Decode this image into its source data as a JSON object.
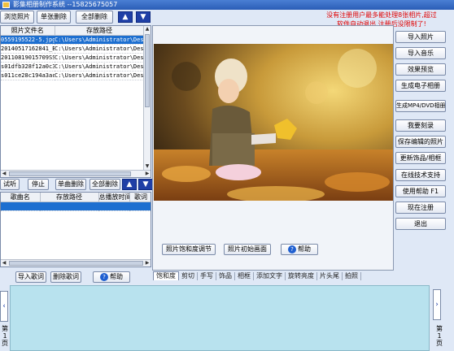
{
  "window": {
    "title": "影集相册制作系统  --15825675057"
  },
  "notice": {
    "line1": "没有注册用户最多能处理8张相片,超过",
    "line2": "软件自动退出,注册后没限制了!"
  },
  "toolbar": {
    "browse": "浏览照片",
    "delete_one": "单张删除",
    "delete_all": "全部删除",
    "up": "▲",
    "down": "▼"
  },
  "photo_list": {
    "columns": [
      "照片文件名",
      "存放路径"
    ],
    "rows": [
      {
        "name": "0559195522-5.jpg",
        "path": "C:\\Users\\Administrator\\Des"
      },
      {
        "name": "20140517162841_B",
        "path": "C:\\Users\\Administrator\\Des"
      },
      {
        "name": "20110819015709SS",
        "path": "C:\\Users\\Administrator\\Des"
      },
      {
        "name": "s01dfb328f12a0c3",
        "path": "C:\\Users\\Administrator\\Des"
      },
      {
        "name": "s011ce28c194a3ac",
        "path": "C:\\Users\\Administrator\\Des"
      }
    ]
  },
  "music_toolbar": {
    "listen": "试听",
    "stop": "停止",
    "delete_one": "单曲删除",
    "delete_all": "全部删除",
    "up": "▲",
    "down": "▼"
  },
  "music_list": {
    "columns": [
      "歌曲名",
      "存放路径",
      "总播放时间",
      "歌词"
    ]
  },
  "lyrics_toolbar": {
    "import": "导入歌词",
    "delete": "删除歌词",
    "help": "帮助"
  },
  "preview": {
    "adjust_saturation": "照片饱和度调节",
    "init_screen": "照片初始画面",
    "help": "帮助"
  },
  "tabs": [
    "饱和度",
    "剪切",
    "手写",
    "饰品",
    "相框",
    "添加文字",
    "旋转亮度",
    "片头尾",
    "拍照"
  ],
  "right_buttons": [
    "导入照片",
    "导入音乐",
    "效果预览",
    "生成电子相册",
    "生成MP4/DVD相册",
    "我要刻录",
    "保存编辑的照片",
    "更新饰品/相框",
    "在线技术支持",
    "使用帮助  F1",
    "现在注册",
    "退出"
  ],
  "pager": {
    "left": [
      "第",
      "1",
      "页"
    ],
    "right": [
      "第",
      "1",
      "页"
    ]
  },
  "icons": {
    "up": "arrow-up-icon",
    "down": "arrow-down-icon",
    "help": "help-icon",
    "app": "app-icon"
  },
  "colors": {
    "title": "#2a5db6",
    "notice": "#e00000",
    "selection": "#1d6fd0",
    "thumb_area": "#b8e2ee",
    "arrow_btn": "#1f3fa6"
  }
}
